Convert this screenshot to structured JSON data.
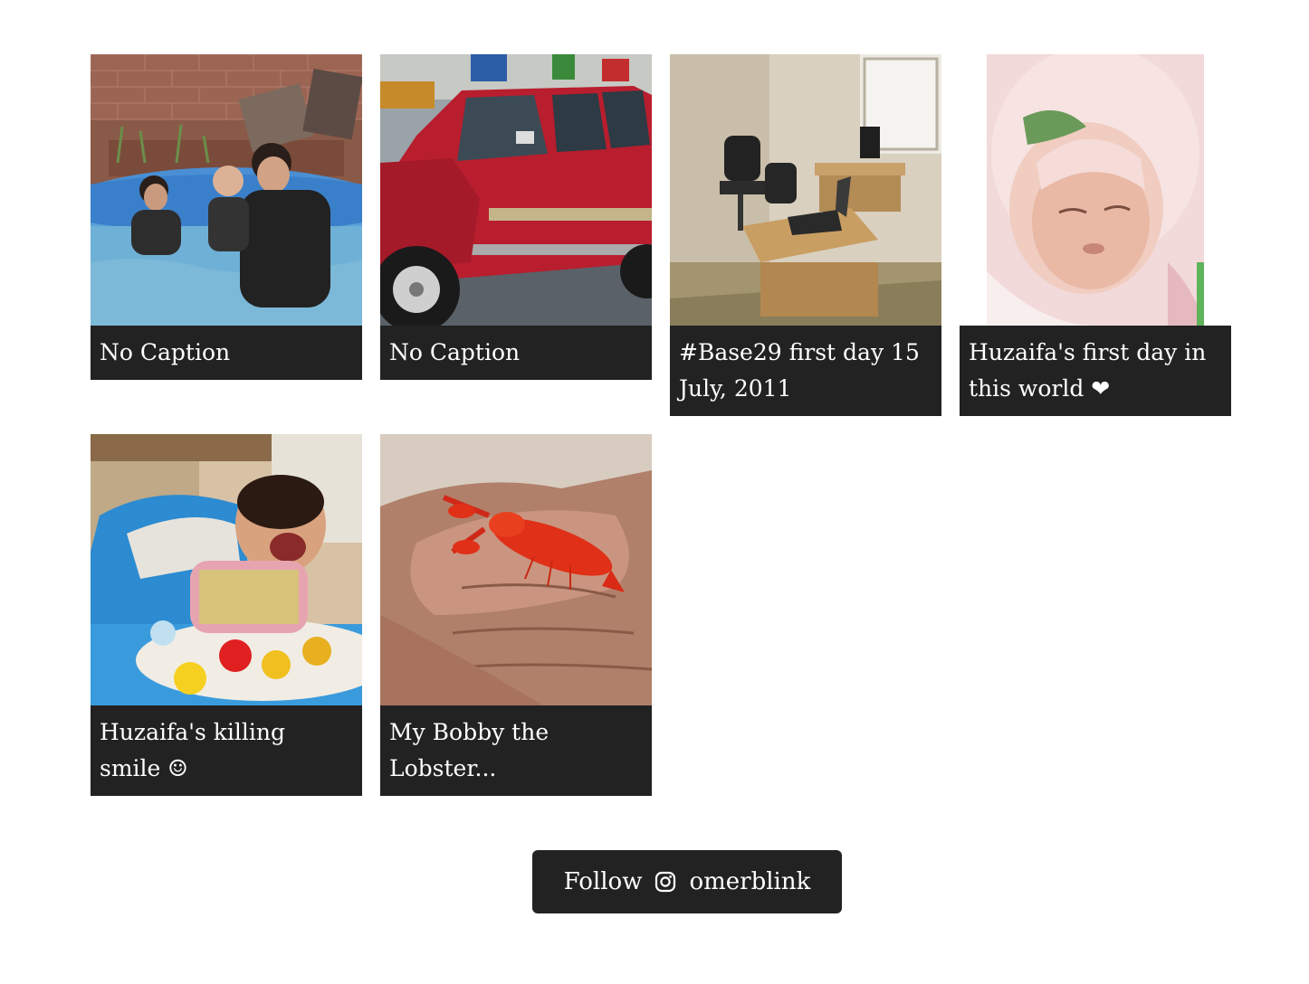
{
  "posts": [
    {
      "caption": "No Caption",
      "image": "pool-with-family-photo"
    },
    {
      "caption": "No Caption",
      "image": "red-suv-photo"
    },
    {
      "caption": "#Base29 first day 15 July, 2011",
      "image": "office-desk-photo"
    },
    {
      "caption": "Huzaifa's first day in this world ❤",
      "image": "newborn-baby-photo"
    },
    {
      "caption": "Huzaifa's killing smile ☺",
      "image": "baby-in-walker-photo"
    },
    {
      "caption": "My Bobby the Lobster...",
      "image": "lobster-in-hand-photo"
    }
  ],
  "follow": {
    "label": "Follow",
    "username": "omerblink",
    "icon": "instagram-icon"
  },
  "colors": {
    "caption_bg": "#222222",
    "caption_text": "#ffffff"
  }
}
